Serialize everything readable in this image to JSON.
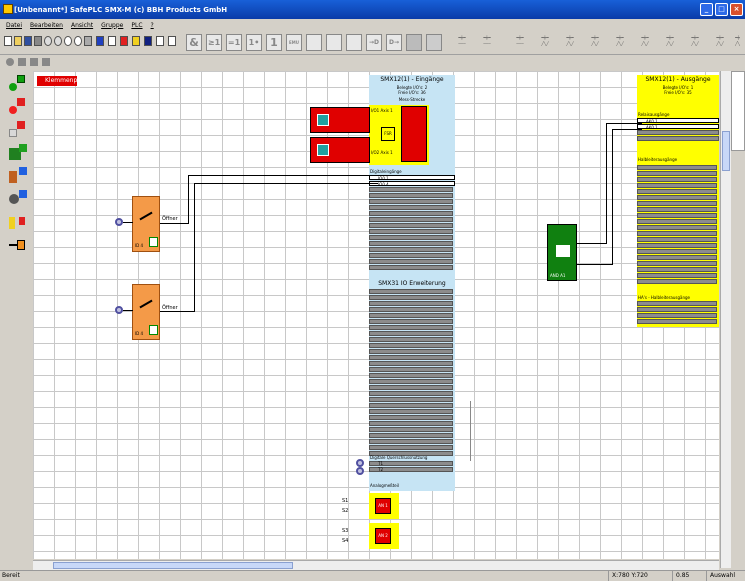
{
  "window": {
    "title": "[Unbenannt*]  SafePLC SMX-M (c) BBH Products GmbH",
    "btn_min": "_",
    "btn_max": "□",
    "btn_close": "×"
  },
  "menu": [
    "Datei",
    "Bearbeiten",
    "Ansicht",
    "Gruppe",
    "PLC",
    "?"
  ],
  "toolbar": {
    "text_buttons": [
      "&",
      "≥1",
      "=1",
      "1•",
      "1",
      "EMU",
      "",
      "",
      "",
      "→D",
      "D→"
    ]
  },
  "canvas": {
    "klemmenplan": "Klemmenplan",
    "inputs_panel": {
      "title": "SMX12(1) - Eingänge",
      "sub1": "Belegte I/O's: 2",
      "sub2": "Freie I/O's: 36",
      "section": "Mess-Strecke",
      "axis1": "I/O1 Axis 1",
      "axis2": "I/O2 Axis 1",
      "fsm": "FSR",
      "dig_title": "Digitaleingänge",
      "io1": "IO0.1",
      "io2": "IO0.4",
      "title2": "SMX31 IO Erweiterung",
      "sec3": "Digitale Querschlussnutzung",
      "q1": "T1",
      "q2": "T2",
      "analog": "Analogmeßteil"
    },
    "outputs_panel": {
      "title": "SMX12(1) - Ausgänge",
      "sub1": "Belegte I/O's: 1",
      "sub2": "Freie I/O's: 35",
      "sec1": "Relaisausgänge",
      "o1": "AK0.1",
      "o2": "AK0.1",
      "sec2": "Halbleiterausgänge",
      "sec3": "HA's - Halbleiterausgänge"
    },
    "switch1": {
      "label": "Öffner",
      "id": "ID  4"
    },
    "switch2": {
      "label": "Öffner",
      "id": "ID  4"
    },
    "and_block": {
      "id": "AND  A1"
    },
    "analog1": {
      "s1": "S1",
      "s2": "S2",
      "label": "AN 1"
    },
    "analog2": {
      "s1": "S3",
      "s2": "S4",
      "label": "AN 2"
    }
  },
  "status": {
    "left": "Bereit",
    "coords": "X:780 Y:720",
    "zoom": "0.85",
    "mode": "Auswahl"
  },
  "colors": {
    "title_bg": "#1860d8",
    "inputs_bg": "#c6e4f4",
    "outputs_bg": "#ffff00",
    "block_red": "#e00000",
    "block_orange": "#f49a48",
    "block_green": "#108010"
  }
}
